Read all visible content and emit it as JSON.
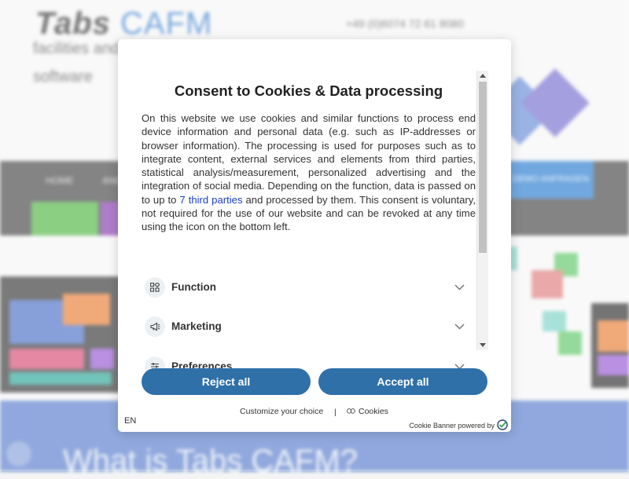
{
  "background": {
    "logo_part1": "Tabs",
    "logo_part2": "CAFM",
    "tagline": "facilities and property management software",
    "phone": "+49 (0)6074 72 61 8080",
    "nav_items": [
      "HOME",
      "ANGEBOT"
    ],
    "nav_cta": "DEMO ANFRAGEN",
    "heading": "What is Tabs CAFM?"
  },
  "consent": {
    "title": "Consent to Cookies & Data processing",
    "body_before_link": "On this website we use cookies and similar functions to process end device information and personal data (e.g. such as IP-addresses or browser information). The processing is used for purposes such as to integrate content, external services and elements from third parties, statistical analysis/measurement, personalized advertising and the integration of social media. Depending on the function, data is passed on to up to ",
    "parties_link": "7 third parties",
    "body_after_link": " and processed by them. This consent is voluntary, not required for the use of our website and can be revoked at any time using the icon on the bottom left.",
    "categories": [
      {
        "label": "Function",
        "icon": "function-grid-icon"
      },
      {
        "label": "Marketing",
        "icon": "megaphone-icon"
      },
      {
        "label": "Preferences",
        "icon": "sliders-icon"
      }
    ],
    "reject_label": "Reject all",
    "accept_label": "Accept all",
    "customize_label": "Customize your choice",
    "separator": "|",
    "cookies_label": "Cookies",
    "language": "EN",
    "powered_by": "Cookie Banner powered by"
  },
  "colors": {
    "button": "#2f70a9",
    "link": "#1a3fc4",
    "nav_bar": "#4a4a4a",
    "cta_green": "#54b948",
    "section_blue": "#5c7fcd"
  }
}
